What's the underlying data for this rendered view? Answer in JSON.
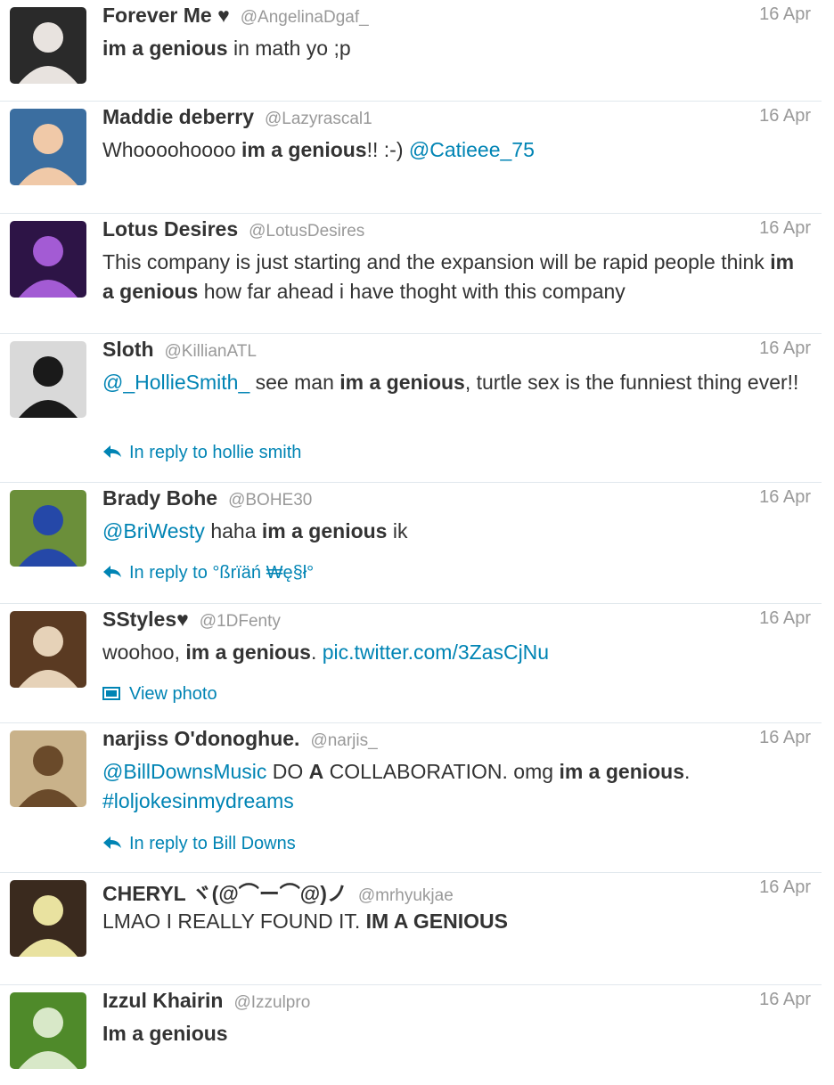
{
  "tweets": [
    {
      "name": "Forever Me ♥",
      "handle": "@AngelinaDgaf_",
      "time": "16 Apr",
      "text": [
        {
          "t": "im a genious",
          "s": "b"
        },
        {
          "t": " in math yo ;p",
          "s": "n"
        }
      ],
      "avatar": {
        "bg": "#2a2a2a",
        "fg": "#e8e3df",
        "icon": "avatar-photo"
      }
    },
    {
      "name": "Maddie deberry",
      "handle": "@Lazyrascal1",
      "time": "16 Apr",
      "text": [
        {
          "t": "Whoooohoooo ",
          "s": "n"
        },
        {
          "t": "im a genious",
          "s": "b"
        },
        {
          "t": "!! :-) ",
          "s": "n"
        },
        {
          "t": "@Catieee_75",
          "s": "l"
        }
      ],
      "avatar": {
        "bg": "#3b6ea0",
        "fg": "#f0c9a8",
        "icon": "avatar-photo"
      }
    },
    {
      "name": "Lotus Desires",
      "handle": "@LotusDesires",
      "time": "16 Apr",
      "text": [
        {
          "t": "This company is just starting and the expansion will be rapid people think ",
          "s": "n"
        },
        {
          "t": "im a genious",
          "s": "b"
        },
        {
          "t": " how far ahead i have thoght with this company",
          "s": "n"
        }
      ],
      "avatar": {
        "bg": "#2d1446",
        "fg": "#a35bd4",
        "icon": "avatar-photo"
      }
    },
    {
      "name": "Sloth",
      "handle": "@KillianATL",
      "time": "16 Apr",
      "text": [
        {
          "t": "@_HollieSmith_",
          "s": "l"
        },
        {
          "t": " see man ",
          "s": "n"
        },
        {
          "t": "im a genious",
          "s": "b"
        },
        {
          "t": ", turtle sex is the funniest thing ever!!",
          "s": "n"
        }
      ],
      "context": {
        "type": "reply",
        "label": "In reply to hollie smith",
        "icon": "reply-arrow-icon"
      },
      "avatar": {
        "bg": "#d9d9d9",
        "fg": "#1a1a1a",
        "icon": "avatar-photo"
      }
    },
    {
      "name": "Brady Bohe",
      "handle": "@BOHE30",
      "time": "16 Apr",
      "text": [
        {
          "t": "@BriWesty",
          "s": "l"
        },
        {
          "t": " haha ",
          "s": "n"
        },
        {
          "t": "im a genious",
          "s": "b"
        },
        {
          "t": " ik",
          "s": "n"
        }
      ],
      "context": {
        "type": "reply",
        "label": "In reply to °ßrïäń ₩ę§ł°",
        "icon": "reply-arrow-icon"
      },
      "avatar": {
        "bg": "#6b8f3a",
        "fg": "#2548a8",
        "icon": "avatar-photo"
      }
    },
    {
      "name": "SStyles♥",
      "handle": "@1DFenty",
      "time": "16 Apr",
      "text": [
        {
          "t": "woohoo, ",
          "s": "n"
        },
        {
          "t": "im a genious",
          "s": "b"
        },
        {
          "t": ". ",
          "s": "n"
        },
        {
          "t": "pic.twitter.com/3ZasCjNu",
          "s": "l"
        }
      ],
      "context": {
        "type": "photo",
        "label": "View photo",
        "icon": "photo-icon"
      },
      "avatar": {
        "bg": "#5a3a22",
        "fg": "#e6d2b8",
        "icon": "avatar-photo"
      }
    },
    {
      "name": "narjiss O'donoghue.",
      "handle": "@narjis_",
      "time": "16 Apr",
      "text": [
        {
          "t": "@BillDownsMusic",
          "s": "l"
        },
        {
          "t": " DO ",
          "s": "n"
        },
        {
          "t": "A",
          "s": "b"
        },
        {
          "t": " COLLABORATION. omg ",
          "s": "n"
        },
        {
          "t": "im a genious",
          "s": "b"
        },
        {
          "t": ". ",
          "s": "n"
        },
        {
          "t": "#loljokesinmydreams",
          "s": "l"
        }
      ],
      "context": {
        "type": "reply",
        "label": "In reply to Bill Downs",
        "icon": "reply-arrow-icon"
      },
      "avatar": {
        "bg": "#c9b28a",
        "fg": "#6a4a2a",
        "icon": "avatar-photo"
      }
    },
    {
      "name": "CHERYL ヾ(@⌒ー⌒@)ノ",
      "handle": "@mrhyukjae",
      "time": "16 Apr",
      "text": [
        {
          "t": "LMAO I REALLY FOUND IT. ",
          "s": "n"
        },
        {
          "t": "IM A GENIOUS",
          "s": "b"
        }
      ],
      "avatar": {
        "bg": "#3a2a1e",
        "fg": "#e9e2a0",
        "icon": "avatar-photo"
      }
    },
    {
      "name": "Izzul Khairin",
      "handle": "@Izzulpro",
      "time": "16 Apr",
      "text": [
        {
          "t": "Im a genious",
          "s": "b"
        }
      ],
      "avatar": {
        "bg": "#4f8a2a",
        "fg": "#d8e8c8",
        "icon": "avatar-photo"
      }
    }
  ]
}
